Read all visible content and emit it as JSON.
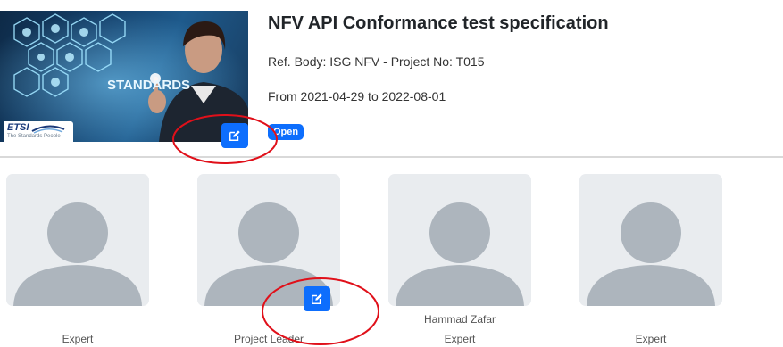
{
  "project": {
    "title": "NFV API Conformance test specification",
    "ref_line": "Ref. Body: ISG NFV - Project No: T015",
    "date_line": "From 2021-04-29 to 2022-08-01",
    "status": "Open",
    "banner": {
      "overlay_text": "STANDARDS",
      "logo_word": "ETSI",
      "logo_tagline": "The Standards People"
    }
  },
  "members": [
    {
      "name": "",
      "role": "Expert"
    },
    {
      "name": "",
      "role": "Project Leader"
    },
    {
      "name": "Hammad Zafar",
      "role": "Expert"
    },
    {
      "name": "",
      "role": "Expert"
    }
  ],
  "colors": {
    "accent": "#0d6efd",
    "annotation": "#e0101a",
    "avatar_bg": "#e9ecef",
    "avatar_figure": "#adb5bd",
    "divider": "#d9d9d9"
  },
  "icons": {
    "edit_buttons": "pencil-square-icon",
    "placeholders": "person-silhouette-icon"
  }
}
